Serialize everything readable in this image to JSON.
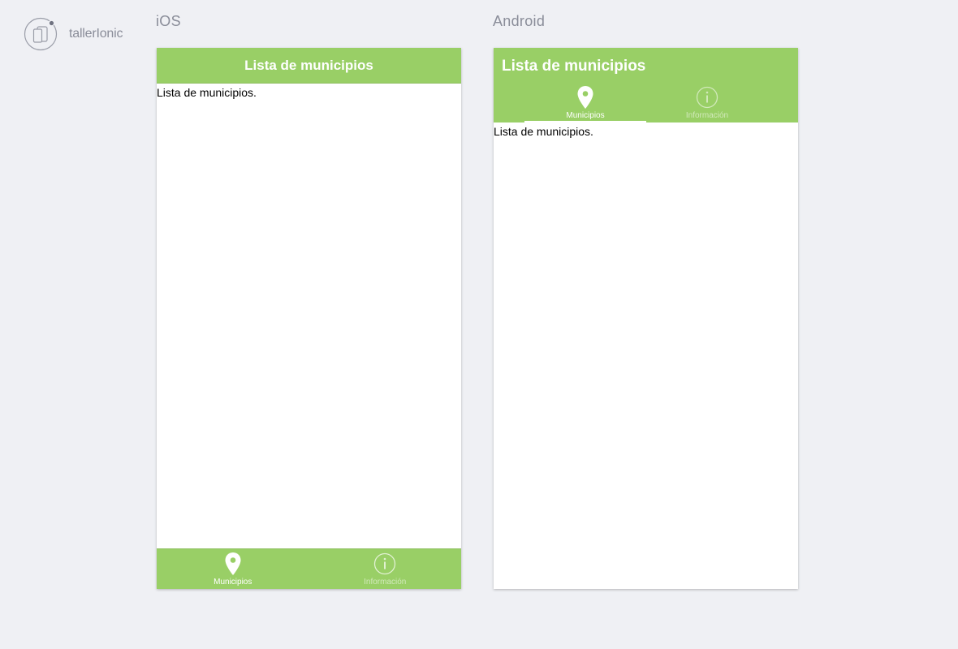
{
  "brand": {
    "name": "tallerIonic"
  },
  "ios": {
    "platform_label": "iOS",
    "header_title": "Lista de municipios",
    "content": "Lista de municipios.",
    "tabs": [
      {
        "label": "Municipios",
        "icon": "location-pin-icon",
        "active": true
      },
      {
        "label": "Información",
        "icon": "info-icon",
        "active": false
      }
    ]
  },
  "android": {
    "platform_label": "Android",
    "header_title": "Lista de municipios",
    "content": "Lista de municipios.",
    "tabs": [
      {
        "label": "Municipios",
        "icon": "location-pin-icon",
        "active": true
      },
      {
        "label": "Información",
        "icon": "info-icon",
        "active": false
      }
    ]
  },
  "colors": {
    "accent": "#99cf66",
    "background": "#eff0f4",
    "label_gray": "#8a8d99"
  }
}
